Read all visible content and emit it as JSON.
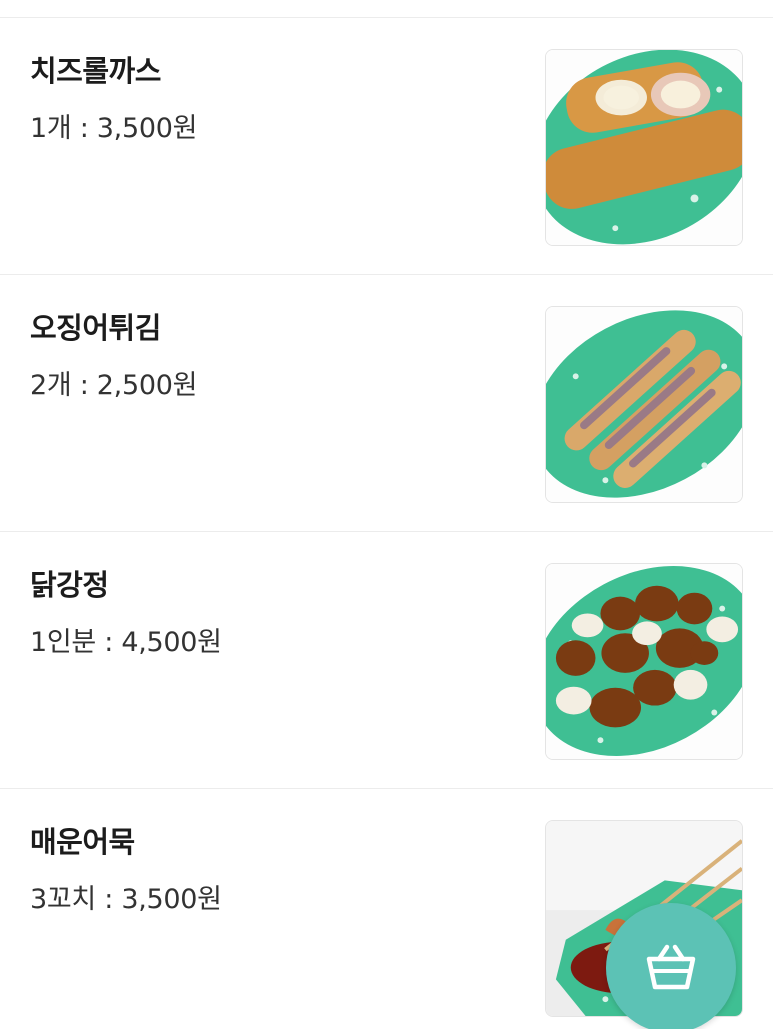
{
  "menu": {
    "items": [
      {
        "name": "치즈롤까스",
        "price": "1개 : 3,500원",
        "image_icon": "cheese-roll-cutlet-photo"
      },
      {
        "name": "오징어튀김",
        "price": "2개 : 2,500원",
        "image_icon": "fried-squid-photo"
      },
      {
        "name": "닭강정",
        "price": "1인분 : 4,500원",
        "image_icon": "sweet-crispy-chicken-photo"
      },
      {
        "name": "매운어묵",
        "price": "3꼬치 : 3,500원",
        "image_icon": "spicy-fishcake-skewer-photo"
      }
    ]
  },
  "cart_button": {
    "icon": "basket-icon"
  },
  "colors": {
    "accent": "#5cc2b5",
    "plate": "#3fbf93",
    "divider": "#ececec"
  }
}
